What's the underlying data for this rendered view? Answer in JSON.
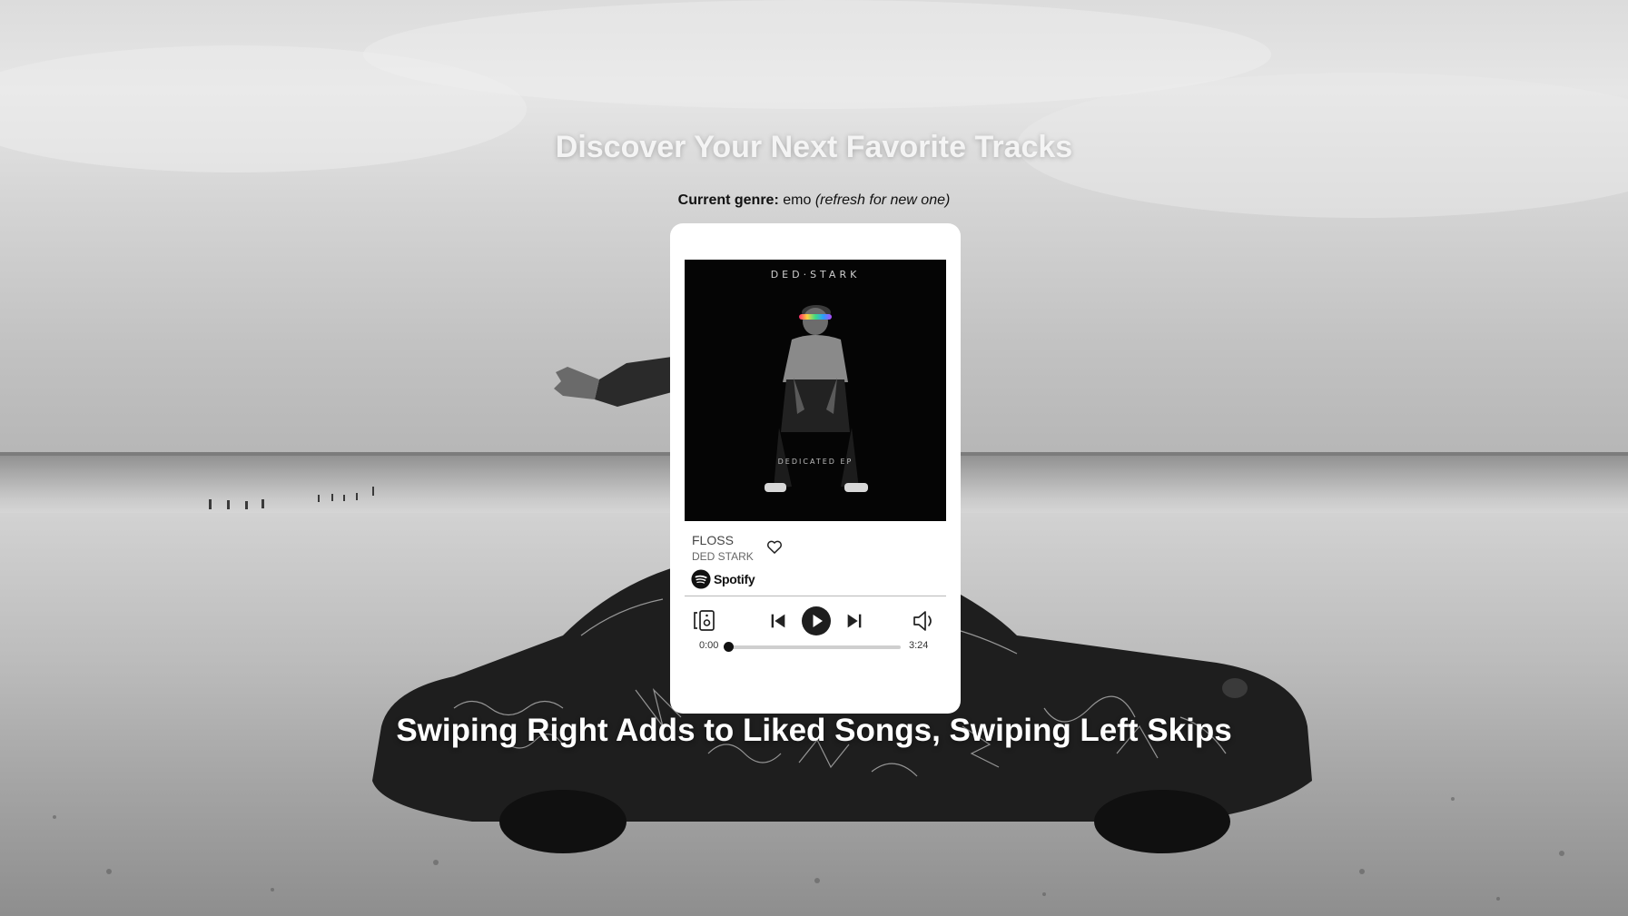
{
  "page": {
    "headline": "Discover Your Next Favorite Tracks",
    "genre_label": "Current genre:",
    "genre_value": "emo",
    "genre_hint": "(refresh for new one)",
    "instructions": "Swiping Right Adds to Liked Songs, Swiping Left Skips"
  },
  "player": {
    "cover_artist_text": "DED·STARK",
    "cover_album_text": "DEDICATED EP",
    "track_title": "FLOSS",
    "track_artist": "DED STARK",
    "service_label": "Spotify",
    "time_current": "0:00",
    "time_total": "3:24",
    "progress_fraction": 0,
    "liked": false
  },
  "icons": {
    "heart": "heart-outline-icon",
    "devices": "connect-device-icon",
    "prev": "skip-previous-icon",
    "play": "play-icon",
    "next": "skip-next-icon",
    "volume": "volume-icon",
    "spotify": "spotify-logo-icon"
  },
  "colors": {
    "card_bg": "#ffffff",
    "headline": "#f4f4f4",
    "controls": "#222222",
    "progress_track": "#cfcfcf"
  }
}
